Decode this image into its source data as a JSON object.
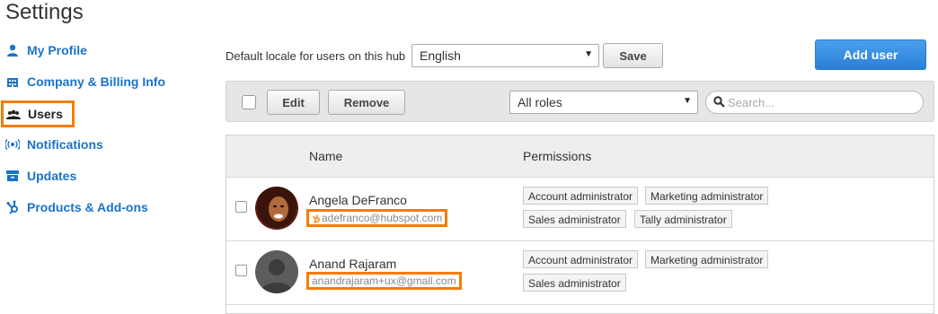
{
  "page": {
    "title": "Settings"
  },
  "sidebar": {
    "items": [
      {
        "label": "My Profile",
        "icon": "user-icon"
      },
      {
        "label": "Company & Billing Info",
        "icon": "building-icon"
      },
      {
        "label": "Users",
        "icon": "users-icon",
        "active": true
      },
      {
        "label": "Notifications",
        "icon": "broadcast-icon"
      },
      {
        "label": "Updates",
        "icon": "archive-icon"
      },
      {
        "label": "Products & Add-ons",
        "icon": "hubspot-sprocket-icon"
      }
    ]
  },
  "locale": {
    "label": "Default locale for users on this hub",
    "selected": "English",
    "save_label": "Save"
  },
  "add_user_label": "Add user",
  "toolbar": {
    "edit_label": "Edit",
    "remove_label": "Remove",
    "roles_selected": "All roles",
    "search_placeholder": "Search..."
  },
  "table": {
    "columns": [
      "Name",
      "Permissions"
    ],
    "users": [
      {
        "name": "Angela DeFranco",
        "email": "adefranco@hubspot.com",
        "permissions": [
          "Account administrator",
          "Marketing administrator",
          "Sales administrator",
          "Tally administrator"
        ]
      },
      {
        "name": "Anand Rajaram",
        "email": "anandrajaram+ux@gmail.com",
        "permissions": [
          "Account administrator",
          "Marketing administrator",
          "Sales administrator"
        ]
      }
    ]
  },
  "colors": {
    "link": "#1a73c9",
    "highlight": "#f57c00",
    "primary_button": "#2b7fd6",
    "toolbar_bg": "#e6e6e6"
  }
}
